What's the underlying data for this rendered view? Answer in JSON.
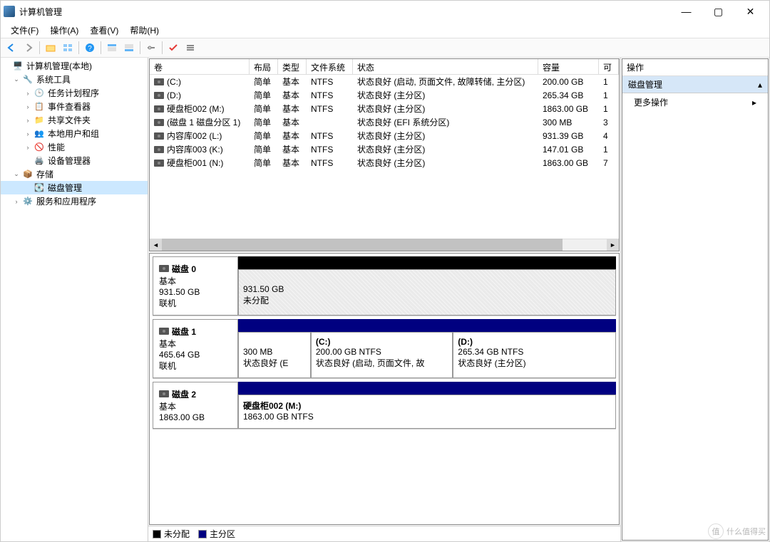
{
  "title": "计算机管理",
  "menu": {
    "file": "文件(F)",
    "action": "操作(A)",
    "view": "查看(V)",
    "help": "帮助(H)"
  },
  "tree": {
    "root": "计算机管理(本地)",
    "system_tools": "系统工具",
    "task_scheduler": "任务计划程序",
    "event_viewer": "事件查看器",
    "shared_folders": "共享文件夹",
    "users_groups": "本地用户和组",
    "performance": "性能",
    "device_manager": "设备管理器",
    "storage": "存储",
    "disk_mgmt": "磁盘管理",
    "services": "服务和应用程序"
  },
  "columns": {
    "volume": "卷",
    "layout": "布局",
    "type": "类型",
    "fs": "文件系统",
    "status": "状态",
    "capacity": "容量",
    "free": "可"
  },
  "volumes": [
    {
      "name": "(C:)",
      "layout": "简单",
      "type": "基本",
      "fs": "NTFS",
      "status": "状态良好 (启动, 页面文件, 故障转储, 主分区)",
      "cap": "200.00 GB",
      "free": "1"
    },
    {
      "name": "(D:)",
      "layout": "简单",
      "type": "基本",
      "fs": "NTFS",
      "status": "状态良好 (主分区)",
      "cap": "265.34 GB",
      "free": "1"
    },
    {
      "name": "硬盘柜002 (M:)",
      "layout": "简单",
      "type": "基本",
      "fs": "NTFS",
      "status": "状态良好 (主分区)",
      "cap": "1863.00 GB",
      "free": "1"
    },
    {
      "name": "(磁盘 1 磁盘分区 1)",
      "layout": "简单",
      "type": "基本",
      "fs": "",
      "status": "状态良好 (EFI 系统分区)",
      "cap": "300 MB",
      "free": "3"
    },
    {
      "name": "内容库002 (L:)",
      "layout": "简单",
      "type": "基本",
      "fs": "NTFS",
      "status": "状态良好 (主分区)",
      "cap": "931.39 GB",
      "free": "4"
    },
    {
      "name": "内容库003 (K:)",
      "layout": "简单",
      "type": "基本",
      "fs": "NTFS",
      "status": "状态良好 (主分区)",
      "cap": "147.01 GB",
      "free": "1"
    },
    {
      "name": "硬盘柜001 (N:)",
      "layout": "简单",
      "type": "基本",
      "fs": "NTFS",
      "status": "状态良好 (主分区)",
      "cap": "1863.00 GB",
      "free": "7"
    }
  ],
  "disks": {
    "d0": {
      "title": "磁盘 0",
      "type": "基本",
      "size": "931.50 GB",
      "status": "联机",
      "part0_size": "931.50 GB",
      "part0_status": "未分配"
    },
    "d1": {
      "title": "磁盘 1",
      "type": "基本",
      "size": "465.64 GB",
      "status": "联机",
      "p0_size": "300 MB",
      "p0_status": "状态良好 (E",
      "p1_label": "(C:)",
      "p1_size": "200.00 GB NTFS",
      "p1_status": "状态良好 (启动, 页面文件, 故",
      "p2_label": "(D:)",
      "p2_size": "265.34 GB NTFS",
      "p2_status": "状态良好 (主分区)"
    },
    "d2": {
      "title": "磁盘 2",
      "type": "基本",
      "size": "1863.00 GB",
      "p0_label": "硬盘柜002  (M:)",
      "p0_size": "1863.00 GB NTFS"
    }
  },
  "legend": {
    "unalloc": "未分配",
    "primary": "主分区"
  },
  "actions": {
    "header": "操作",
    "section": "磁盘管理",
    "more": "更多操作"
  },
  "watermark": {
    "char": "值",
    "text": "什么值得买"
  }
}
